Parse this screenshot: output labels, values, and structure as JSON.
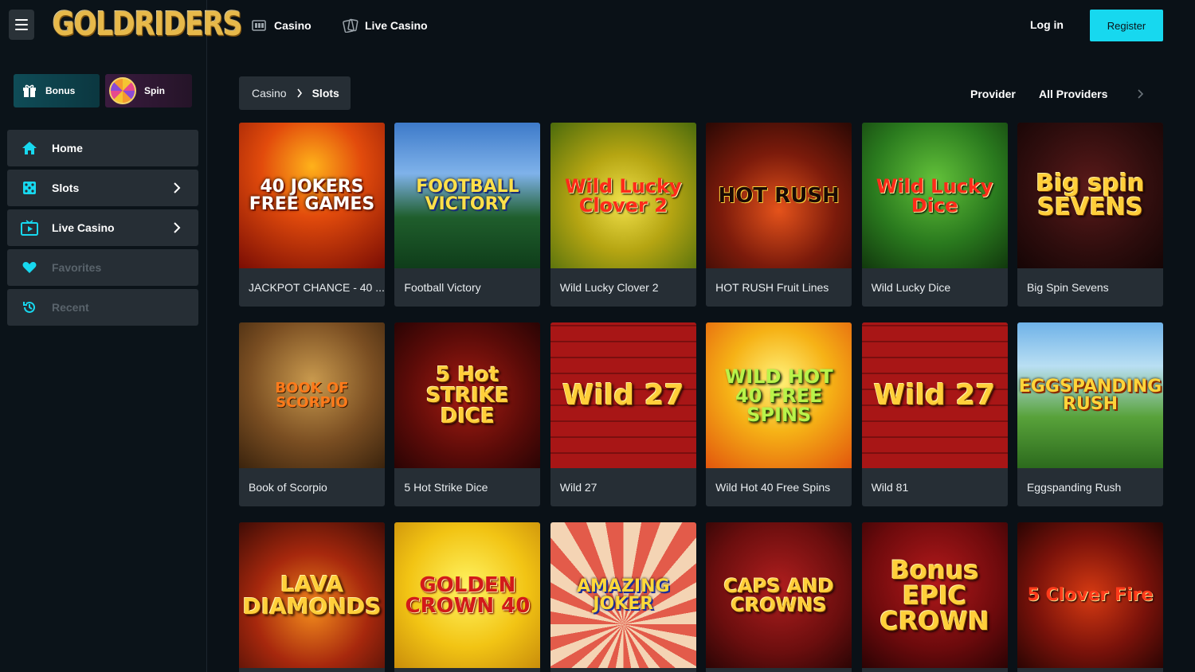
{
  "header": {
    "logo_text": "GOLDRIDERS",
    "nav": [
      {
        "label": "Casino",
        "icon": "casino-icon"
      },
      {
        "label": "Live Casino",
        "icon": "live-casino-icon"
      }
    ],
    "login_label": "Log in",
    "register_label": "Register"
  },
  "promos": {
    "bonus_label": "Bonus",
    "spin_label": "Spin"
  },
  "sidebar": {
    "items": [
      {
        "label": "Home",
        "icon": "home-icon",
        "active": true
      },
      {
        "label": "Slots",
        "icon": "dice-icon",
        "has_children": true
      },
      {
        "label": "Live Casino",
        "icon": "tv-icon",
        "has_children": true
      },
      {
        "label": "Favorites",
        "icon": "heart-icon",
        "disabled": true
      },
      {
        "label": "Recent",
        "icon": "history-icon",
        "disabled": true
      }
    ]
  },
  "breadcrumb": {
    "items": [
      "Casino",
      "Slots"
    ]
  },
  "filter": {
    "provider_label": "Provider",
    "provider_value": "All Providers"
  },
  "games": [
    {
      "title": "JACKPOT CHANCE - 40 ...",
      "art": "40 JOKERS FREE GAMES"
    },
    {
      "title": "Football Victory",
      "art": "FOOTBALL VICTORY"
    },
    {
      "title": "Wild Lucky Clover 2",
      "art": "Wild Lucky Clover 2"
    },
    {
      "title": "HOT RUSH Fruit Lines",
      "art": "HOT RUSH"
    },
    {
      "title": "Wild Lucky Dice",
      "art": "Wild Lucky Dice"
    },
    {
      "title": "Big Spin Sevens",
      "art": "Big spin SEVENS"
    },
    {
      "title": "Book of Scorpio",
      "art": "BOOK OF SCORPIO"
    },
    {
      "title": "5 Hot Strike Dice",
      "art": "5 Hot STRIKE DICE"
    },
    {
      "title": "Wild 27",
      "art": "Wild 27"
    },
    {
      "title": "Wild Hot 40 Free Spins",
      "art": "WILD HOT 40 FREE SPINS"
    },
    {
      "title": "Wild 81",
      "art": "Wild 27"
    },
    {
      "title": "Eggspanding Rush",
      "art": "EGGSPANDING RUSH"
    },
    {
      "title": "",
      "art": "LAVA DIAMONDS"
    },
    {
      "title": "",
      "art": "GOLDEN CROWN 40"
    },
    {
      "title": "",
      "art": "AMAZING JOKER"
    },
    {
      "title": "",
      "art": "CAPS AND CROWNS"
    },
    {
      "title": "",
      "art": "Bonus EPIC CROWN"
    },
    {
      "title": "",
      "art": "5 Clover Fire"
    }
  ],
  "colors": {
    "accent": "#17d8ef",
    "background": "#0a1117",
    "card": "#262e35"
  }
}
